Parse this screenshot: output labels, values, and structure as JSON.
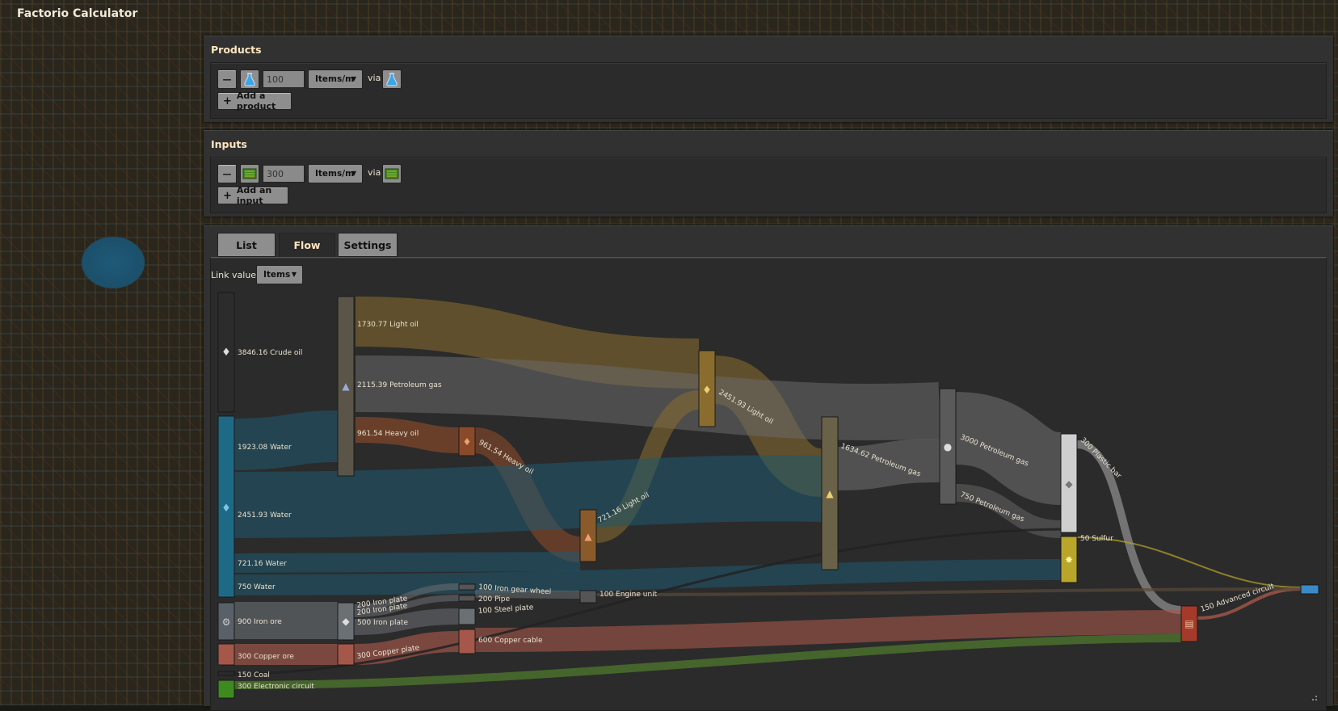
{
  "app": {
    "title": "Factorio Calculator"
  },
  "products": {
    "title": "Products",
    "rows": [
      {
        "amount": "100",
        "unit": "Items/m",
        "via": "via",
        "remove": "—"
      }
    ],
    "add_label": "Add a product"
  },
  "inputs": {
    "title": "Inputs",
    "rows": [
      {
        "amount": "300",
        "unit": "Items/m",
        "via": "via",
        "remove": "—"
      }
    ],
    "add_label": "Add an input"
  },
  "tabs": [
    {
      "label": "List"
    },
    {
      "label": "Flow",
      "active": true
    },
    {
      "label": "Settings"
    }
  ],
  "flow": {
    "link_value_label": "Link value",
    "link_value": "Items",
    "labels": [
      "3846.16 Crude oil",
      "1923.08 Water",
      "2451.93 Water",
      "721.16 Water",
      "750 Water",
      "900 Iron ore",
      "300 Copper ore",
      "150 Coal",
      "300 Electronic circuit",
      "1730.77 Light oil",
      "2115.39 Petroleum gas",
      "961.54 Heavy oil",
      "200 Iron plate",
      "200 Iron plate",
      "500 Iron plate",
      "300 Copper plate",
      "961.54 Heavy oil",
      "100 Iron gear wheel",
      "200 Pipe",
      "100 Steel plate",
      "600 Copper cable",
      "721.16 Light oil",
      "100 Engine unit",
      "2451.93 Light oil",
      "1634.62 Petroleum gas",
      "3000 Petroleum gas",
      "750 Petroleum gas",
      "300 Plastic bar",
      "50 Sulfur",
      "150 Advanced circuit"
    ]
  },
  "colors": {
    "light_oil": "#8a6d2e",
    "petroleum_gas": "#6a6a6a",
    "heavy_oil": "#8a4a2a",
    "water": "#1e5a70",
    "copper": "#a5574a",
    "circuit": "#4f7a2e",
    "iron": "#6b7074",
    "sulfur": "#b8a52a",
    "plastic": "#bbbbbb"
  }
}
